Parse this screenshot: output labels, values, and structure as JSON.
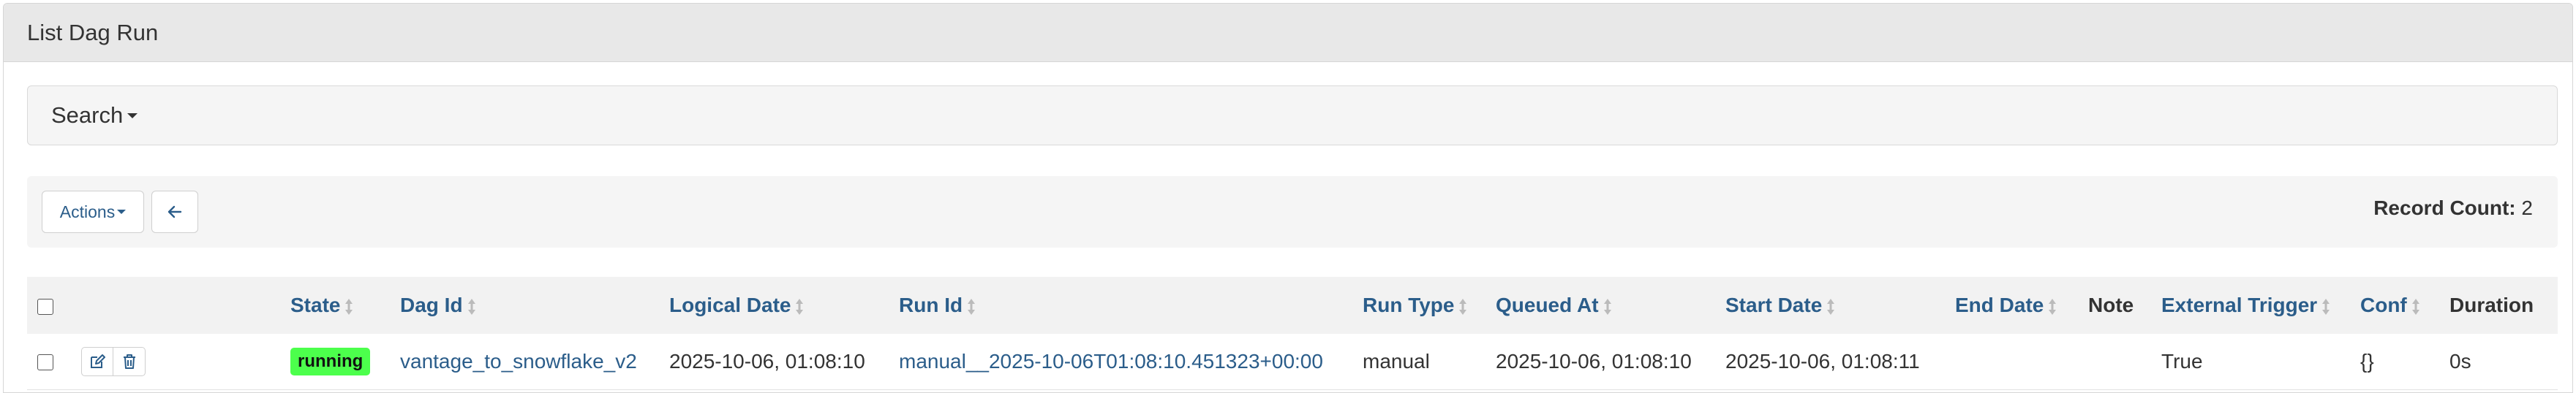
{
  "panel": {
    "title": "List Dag Run"
  },
  "search": {
    "label": "Search"
  },
  "toolbar": {
    "actions_label": "Actions",
    "record_count_label": "Record Count:",
    "record_count": "2"
  },
  "table": {
    "headers": {
      "state": "State",
      "dag_id": "Dag Id",
      "logical_date": "Logical Date",
      "run_id": "Run Id",
      "run_type": "Run Type",
      "queued_at": "Queued At",
      "start_date": "Start Date",
      "end_date": "End Date",
      "note": "Note",
      "external_trigger": "External Trigger",
      "conf": "Conf",
      "duration": "Duration"
    },
    "rows": [
      {
        "state": "running",
        "dag_id": "vantage_to_snowflake_v2",
        "logical_date": "2025-10-06, 01:08:10",
        "run_id": "manual__2025-10-06T01:08:10.451323+00:00",
        "run_type": "manual",
        "queued_at": "2025-10-06, 01:08:10",
        "start_date": "2025-10-06, 01:08:11",
        "end_date": "",
        "note": "",
        "external_trigger": "True",
        "conf": "{}",
        "duration": "0s"
      }
    ]
  },
  "colors": {
    "link": "#2b5d8a",
    "running_badge": "#4cff4c",
    "panel_heading_bg": "#e8e8e8"
  },
  "icons": {
    "edit": "edit-icon",
    "delete": "trash-icon",
    "back": "arrow-left-icon",
    "sort": "sort-icon"
  }
}
